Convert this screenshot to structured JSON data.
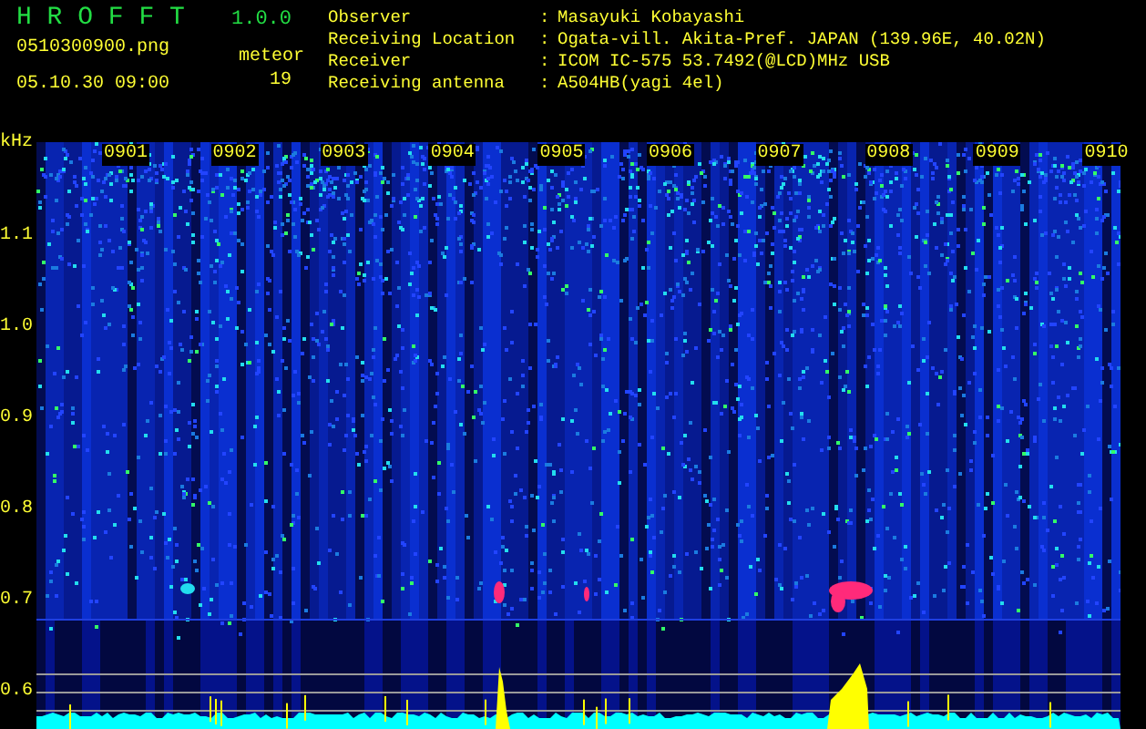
{
  "header": {
    "app_name": "H R O F F T",
    "version": "1.0.0",
    "file_name": "0510300900.png",
    "timestamp": "05.10.30 09:00",
    "meteor_label": "meteor",
    "meteor_count": "19"
  },
  "station": [
    {
      "label": "Observer",
      "separator": ":",
      "value": "Masayuki Kobayashi"
    },
    {
      "label": "Receiving Location",
      "separator": ":",
      "value": "Ogata-vill. Akita-Pref. JAPAN (139.96E, 40.02N)"
    },
    {
      "label": "Receiver",
      "separator": ":",
      "value": "ICOM IC-575 53.7492(@LCD)MHz USB"
    },
    {
      "label": "Receiving antenna",
      "separator": ":",
      "value": "A504HB(yagi 4el)"
    }
  ],
  "spectrogram": {
    "unit": "kHz",
    "y_labels": [
      "1.1",
      "1.0",
      "0.9",
      "0.8",
      "0.7",
      "0.6"
    ],
    "time_labels": [
      "0901",
      "0902",
      "0903",
      "0904",
      "0905",
      "0906",
      "0907",
      "0908",
      "0909",
      "0910"
    ]
  }
}
